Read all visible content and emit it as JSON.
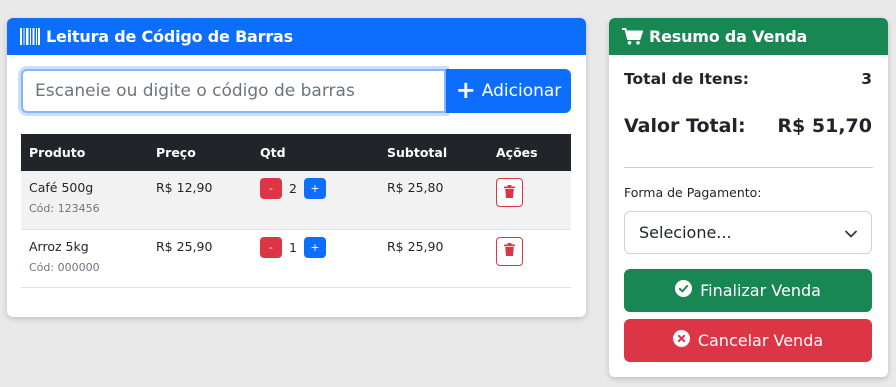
{
  "scanner": {
    "title": "Leitura de Código de Barras",
    "icon": "barcode-icon",
    "input_placeholder": "Escaneie ou digite o código de barras",
    "input_value": "",
    "add_button_label": "Adicionar",
    "table": {
      "headers": [
        "Produto",
        "Preço",
        "Qtd",
        "Subtotal",
        "Ações"
      ],
      "rows": [
        {
          "name": "Café 500g",
          "code": "Cód: 123456",
          "price": "R$ 12,90",
          "qty": "2",
          "subtotal": "R$ 25,80",
          "minus_label": "-",
          "plus_label": "+"
        },
        {
          "name": "Arroz 5kg",
          "code": "Cód: 000000",
          "price": "R$ 25,90",
          "qty": "1",
          "subtotal": "R$ 25,90",
          "minus_label": "-",
          "plus_label": "+"
        }
      ]
    }
  },
  "summary": {
    "title": "Resumo da Venda",
    "icon": "cart-icon",
    "items_label": "Total de Itens:",
    "items_value": "3",
    "total_label": "Valor Total:",
    "total_value": "R$ 51,70",
    "payment_label": "Forma de Pagamento:",
    "payment_selected": "Selecione...",
    "finish_label": "Finalizar Venda",
    "cancel_label": "Cancelar Venda"
  },
  "colors": {
    "primary": "#0d6efd",
    "success": "#198754",
    "danger": "#dc3545",
    "dark": "#212529",
    "background": "#e9e9e9"
  }
}
